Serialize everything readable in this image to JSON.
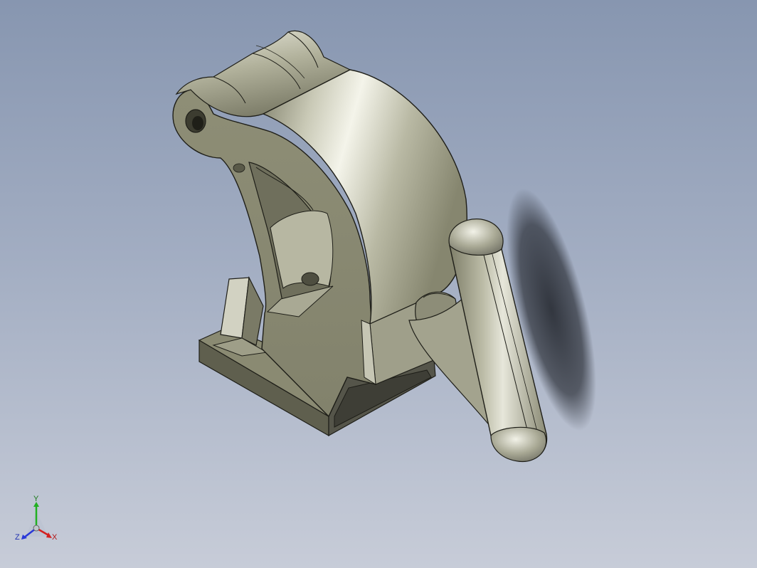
{
  "triad": {
    "x_label": "X",
    "y_label": "Y",
    "z_label": "Z",
    "x_color": "#d42020",
    "y_color": "#22b022",
    "z_color": "#2a38d8"
  },
  "scene": {
    "background_top": "#8796b0",
    "background_bottom": "#c7ccd8",
    "part_color": "#8f8f78"
  }
}
